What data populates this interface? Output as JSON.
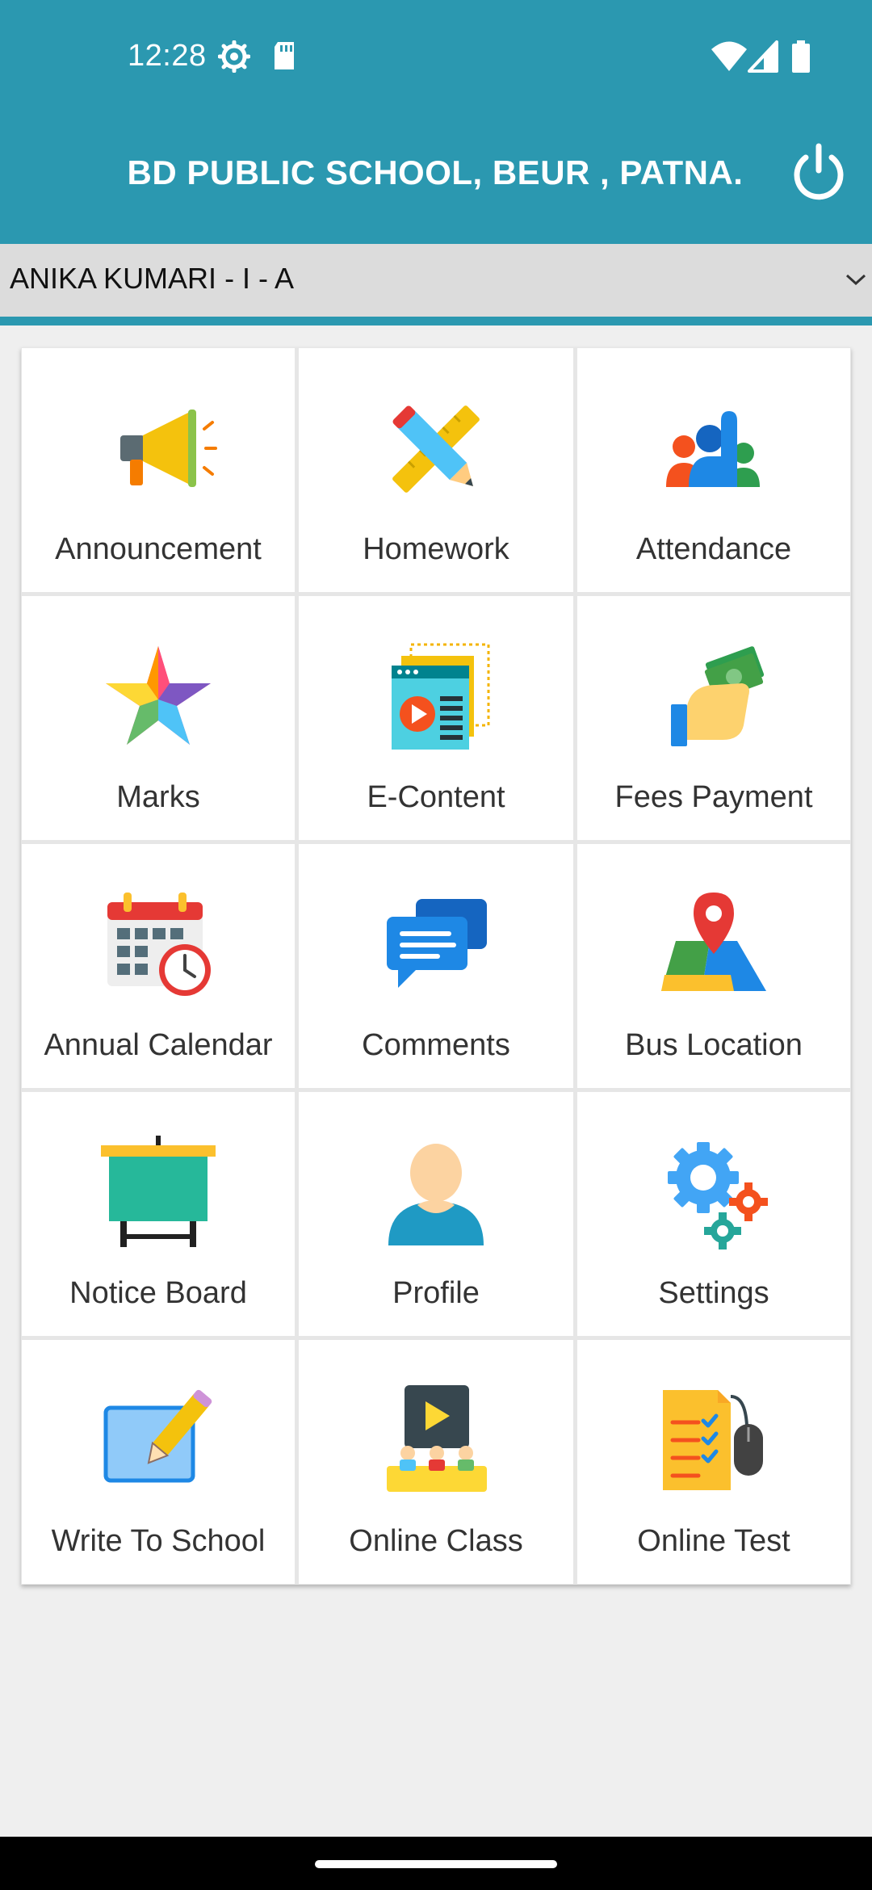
{
  "status_bar": {
    "time": "12:28",
    "left_icons": [
      "settings-gear-icon",
      "sd-card-icon"
    ],
    "right_icons": [
      "wifi-icon",
      "cellular-signal-icon",
      "battery-icon"
    ]
  },
  "header": {
    "title": "BD PUBLIC SCHOOL, BEUR , PATNA.",
    "power_icon": "power-icon",
    "background_color": "#2b98b0"
  },
  "student_selector": {
    "selected": "ANIKA KUMARI - I - A",
    "icon": "chevron-down-icon"
  },
  "menu": {
    "items": [
      {
        "label": "Announcement",
        "icon": "megaphone-icon"
      },
      {
        "label": "Homework",
        "icon": "pencil-ruler-icon"
      },
      {
        "label": "Attendance",
        "icon": "raised-hand-group-icon"
      },
      {
        "label": "Marks",
        "icon": "star-icon"
      },
      {
        "label": "E-Content",
        "icon": "video-document-icon"
      },
      {
        "label": "Fees Payment",
        "icon": "hand-money-icon"
      },
      {
        "label": "Annual Calendar",
        "icon": "calendar-clock-icon"
      },
      {
        "label": "Comments",
        "icon": "chat-bubbles-icon"
      },
      {
        "label": "Bus Location",
        "icon": "map-pin-icon"
      },
      {
        "label": "Notice Board",
        "icon": "board-easel-icon"
      },
      {
        "label": "Profile",
        "icon": "user-avatar-icon"
      },
      {
        "label": "Settings",
        "icon": "gears-icon"
      },
      {
        "label": "Write To School",
        "icon": "write-pencil-icon"
      },
      {
        "label": "Online Class",
        "icon": "online-classroom-icon"
      },
      {
        "label": "Online Test",
        "icon": "test-checklist-mouse-icon"
      }
    ]
  }
}
